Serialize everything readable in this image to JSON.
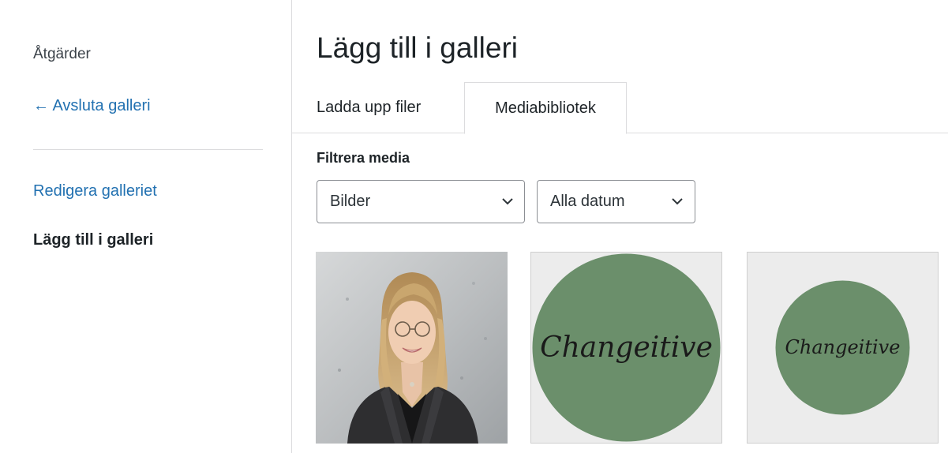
{
  "sidebar": {
    "heading": "Åtgärder",
    "back_link": "← Avsluta galleri",
    "edit_link": "Redigera galleriet",
    "current": "Lägg till i galleri"
  },
  "main": {
    "title": "Lägg till i galleri",
    "tabs": [
      {
        "label": "Ladda upp filer",
        "active": false
      },
      {
        "label": "Mediabibliotek",
        "active": true
      }
    ],
    "filter": {
      "label": "Filtrera media",
      "type_value": "Bilder",
      "date_value": "Alla datum"
    },
    "thumbnails": [
      {
        "kind": "photo",
        "alt": ""
      },
      {
        "kind": "logo",
        "logo_text": "Changeitive"
      },
      {
        "kind": "logo",
        "logo_text": "Changeitive"
      }
    ]
  },
  "colors": {
    "link": "#2271b1",
    "logo_green": "#6b8f6b",
    "border": "#dcdcde"
  }
}
